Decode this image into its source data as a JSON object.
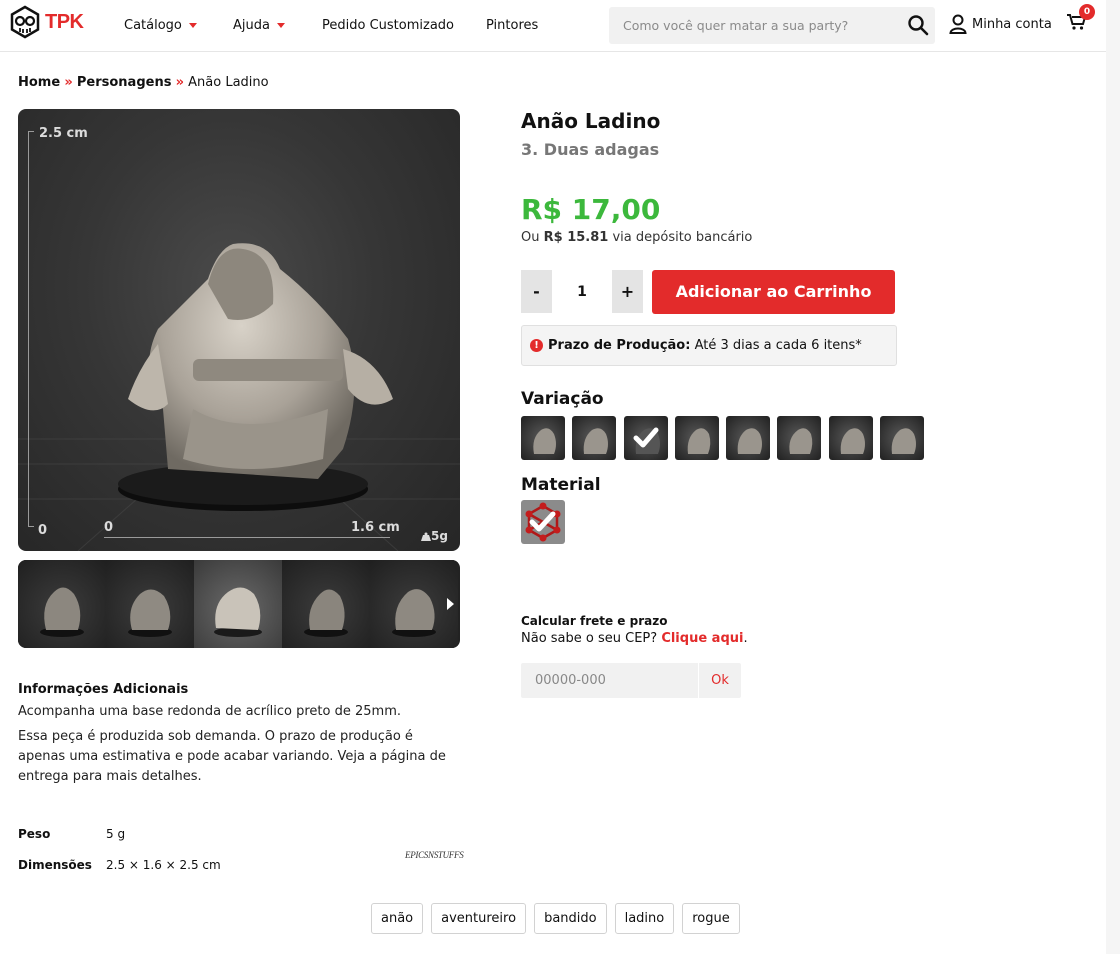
{
  "header": {
    "logo_text": "TPK",
    "nav": [
      {
        "label": "Catálogo",
        "dropdown": true
      },
      {
        "label": "Ajuda",
        "dropdown": true
      },
      {
        "label": "Pedido Customizado",
        "dropdown": false
      },
      {
        "label": "Pintores",
        "dropdown": false
      }
    ],
    "search_placeholder": "Como você quer matar a sua party?",
    "account_label": "Minha conta",
    "cart_count": "0"
  },
  "breadcrumb": {
    "home": "Home",
    "category": "Personagens",
    "current": "Anão Ladino",
    "separator": "»"
  },
  "gallery": {
    "ruler_height": "2.5 cm",
    "ruler_zero_left": "0",
    "ruler_zero_bottom": "0",
    "ruler_width": "1.6 cm",
    "weight_badge": "5g",
    "thumbnail_count": 5,
    "active_thumbnail": 3
  },
  "product": {
    "title": "Anão Ladino",
    "variant": "3. Duas adagas",
    "price": "R$ 17,00",
    "alt_price_prefix": "Ou",
    "alt_price": "R$ 15.81",
    "alt_price_suffix": "via depósito bancário",
    "quantity": "1",
    "qty_minus": "-",
    "qty_plus": "+",
    "add_to_cart": "Adicionar ao Carrinho",
    "production_label": "Prazo de Produção:",
    "production_value": "Até 3 dias a cada 6 itens*",
    "variation_label": "Variação",
    "variation_count": 8,
    "variation_selected": 3,
    "material_label": "Material"
  },
  "shipping": {
    "title": "Calcular frete e prazo",
    "question": "Não sabe o seu CEP?",
    "link": "Clique aqui",
    "link_suffix": ".",
    "cep_placeholder": "00000-000",
    "ok_label": "Ok"
  },
  "info": {
    "heading": "Informações Adicionais",
    "p1": "Acompanha uma base redonda de acrílico preto de 25mm.",
    "p2": "Essa peça é produzida sob demanda. O prazo de produção é apenas uma estimativa e pode acabar variando. Veja a página de entrega para mais detalhes.",
    "weight_label": "Peso",
    "weight_value": "5 g",
    "dims_label": "Dimensões",
    "dims_value": "2.5 × 1.6 × 2.5 cm",
    "brand": "EPICSNSTUFFS"
  },
  "tags": [
    "anão",
    "aventureiro",
    "bandido",
    "ladino",
    "rogue"
  ],
  "colors": {
    "accent": "#e32b2b",
    "price": "#3cb83c"
  }
}
